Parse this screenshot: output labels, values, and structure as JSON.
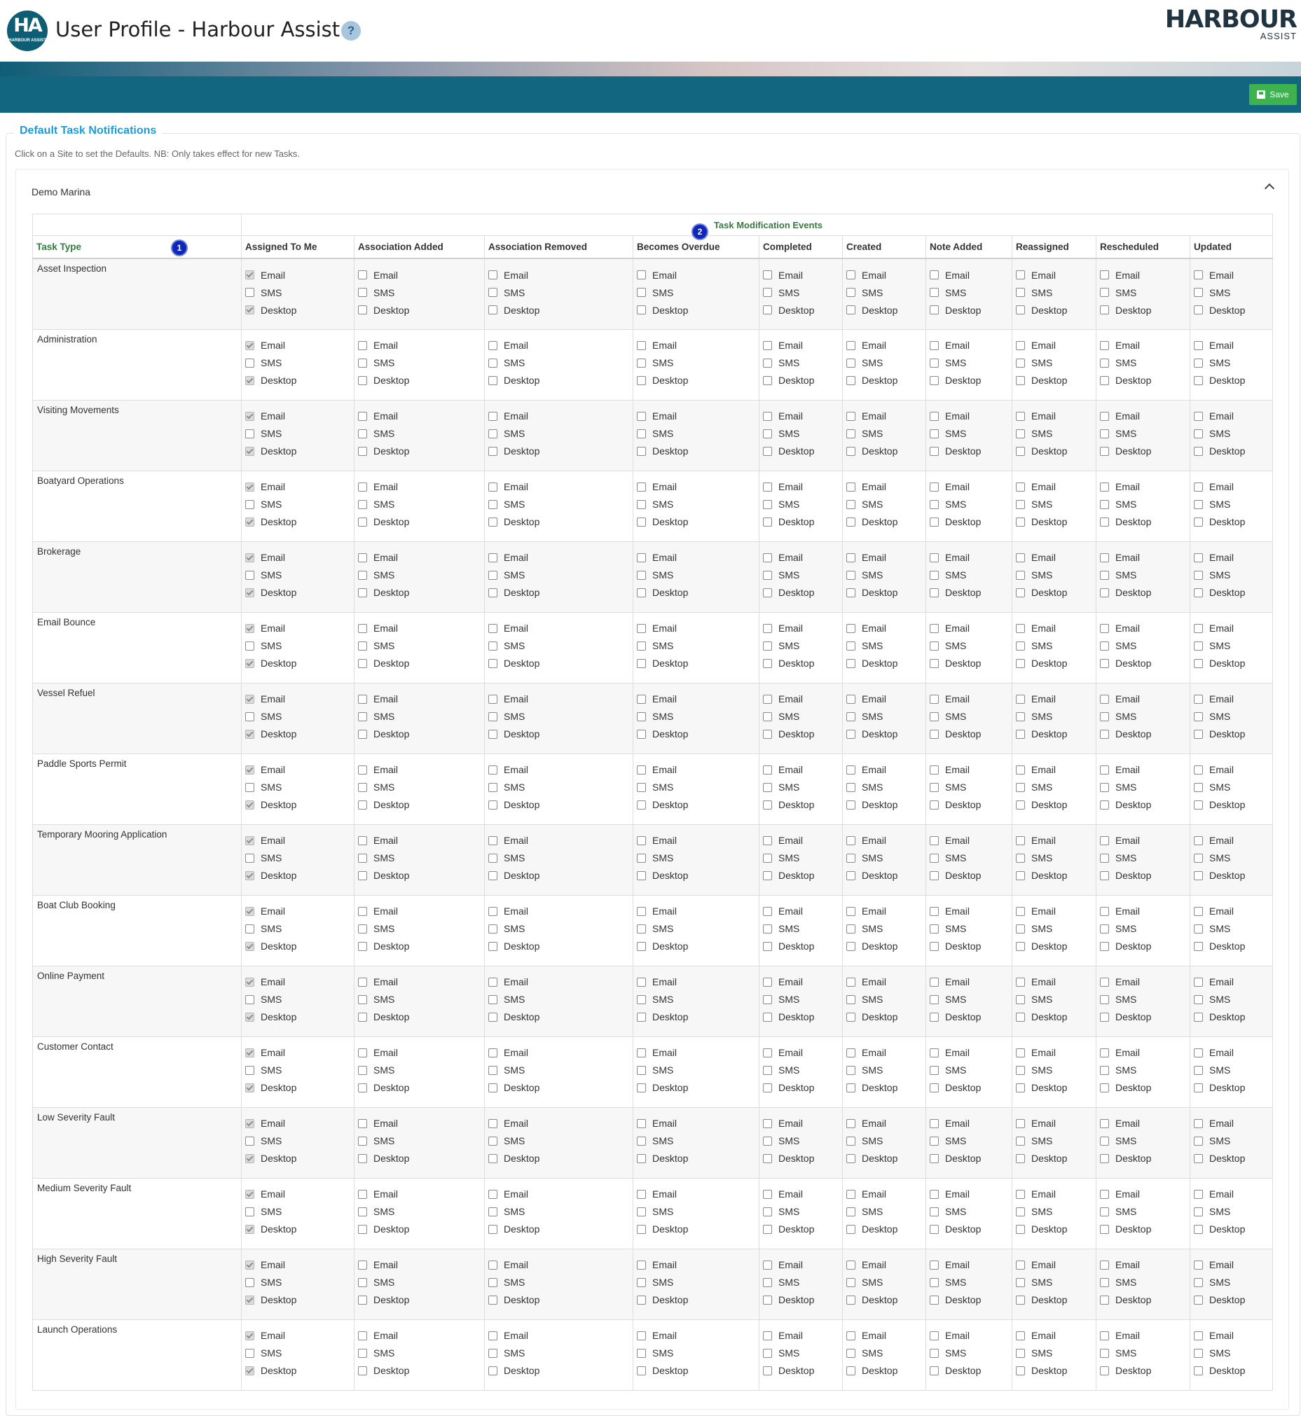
{
  "header": {
    "logo_text": "HA",
    "logo_sub": "HARBOUR ASSIST",
    "title": "User Profile - Harbour Assist",
    "help_glyph": "?",
    "brand_name": "HARBOUR",
    "brand_sub": "ASSIST"
  },
  "toolbar": {
    "save_label": "Save"
  },
  "section": {
    "legend": "Default Task Notifications",
    "hint": "Click on a Site to set the Defaults. NB: Only takes effect for new Tasks.",
    "site_name": "Demo Marina"
  },
  "table": {
    "group_header": "Task Modification Events",
    "task_type_header": "Task Type",
    "marker_1": "1",
    "marker_2": "2",
    "option_labels": [
      "Email",
      "SMS",
      "Desktop"
    ],
    "events": [
      "Assigned To Me",
      "Association Added",
      "Association Removed",
      "Becomes Overdue",
      "Completed",
      "Created",
      "Note Added",
      "Reassigned",
      "Rescheduled",
      "Updated"
    ],
    "task_types": [
      "Asset Inspection",
      "Administration",
      "Visiting Movements",
      "Boatyard Operations",
      "Brokerage",
      "Email Bounce",
      "Vessel Refuel",
      "Paddle Sports Permit",
      "Temporary Mooring Application",
      "Boat Club Booking",
      "Online Payment",
      "Customer Contact",
      "Low Severity Fault",
      "Medium Severity Fault",
      "High Severity Fault",
      "Launch Operations"
    ],
    "default_checked": {
      "Assigned To Me": {
        "Email": true,
        "SMS": false,
        "Desktop": true
      }
    }
  },
  "colors": {
    "nav": "#12667f",
    "save": "#3db24e",
    "legend": "#1e9bd6",
    "header_green": "#377a3f",
    "marker": "#0f27b8"
  }
}
